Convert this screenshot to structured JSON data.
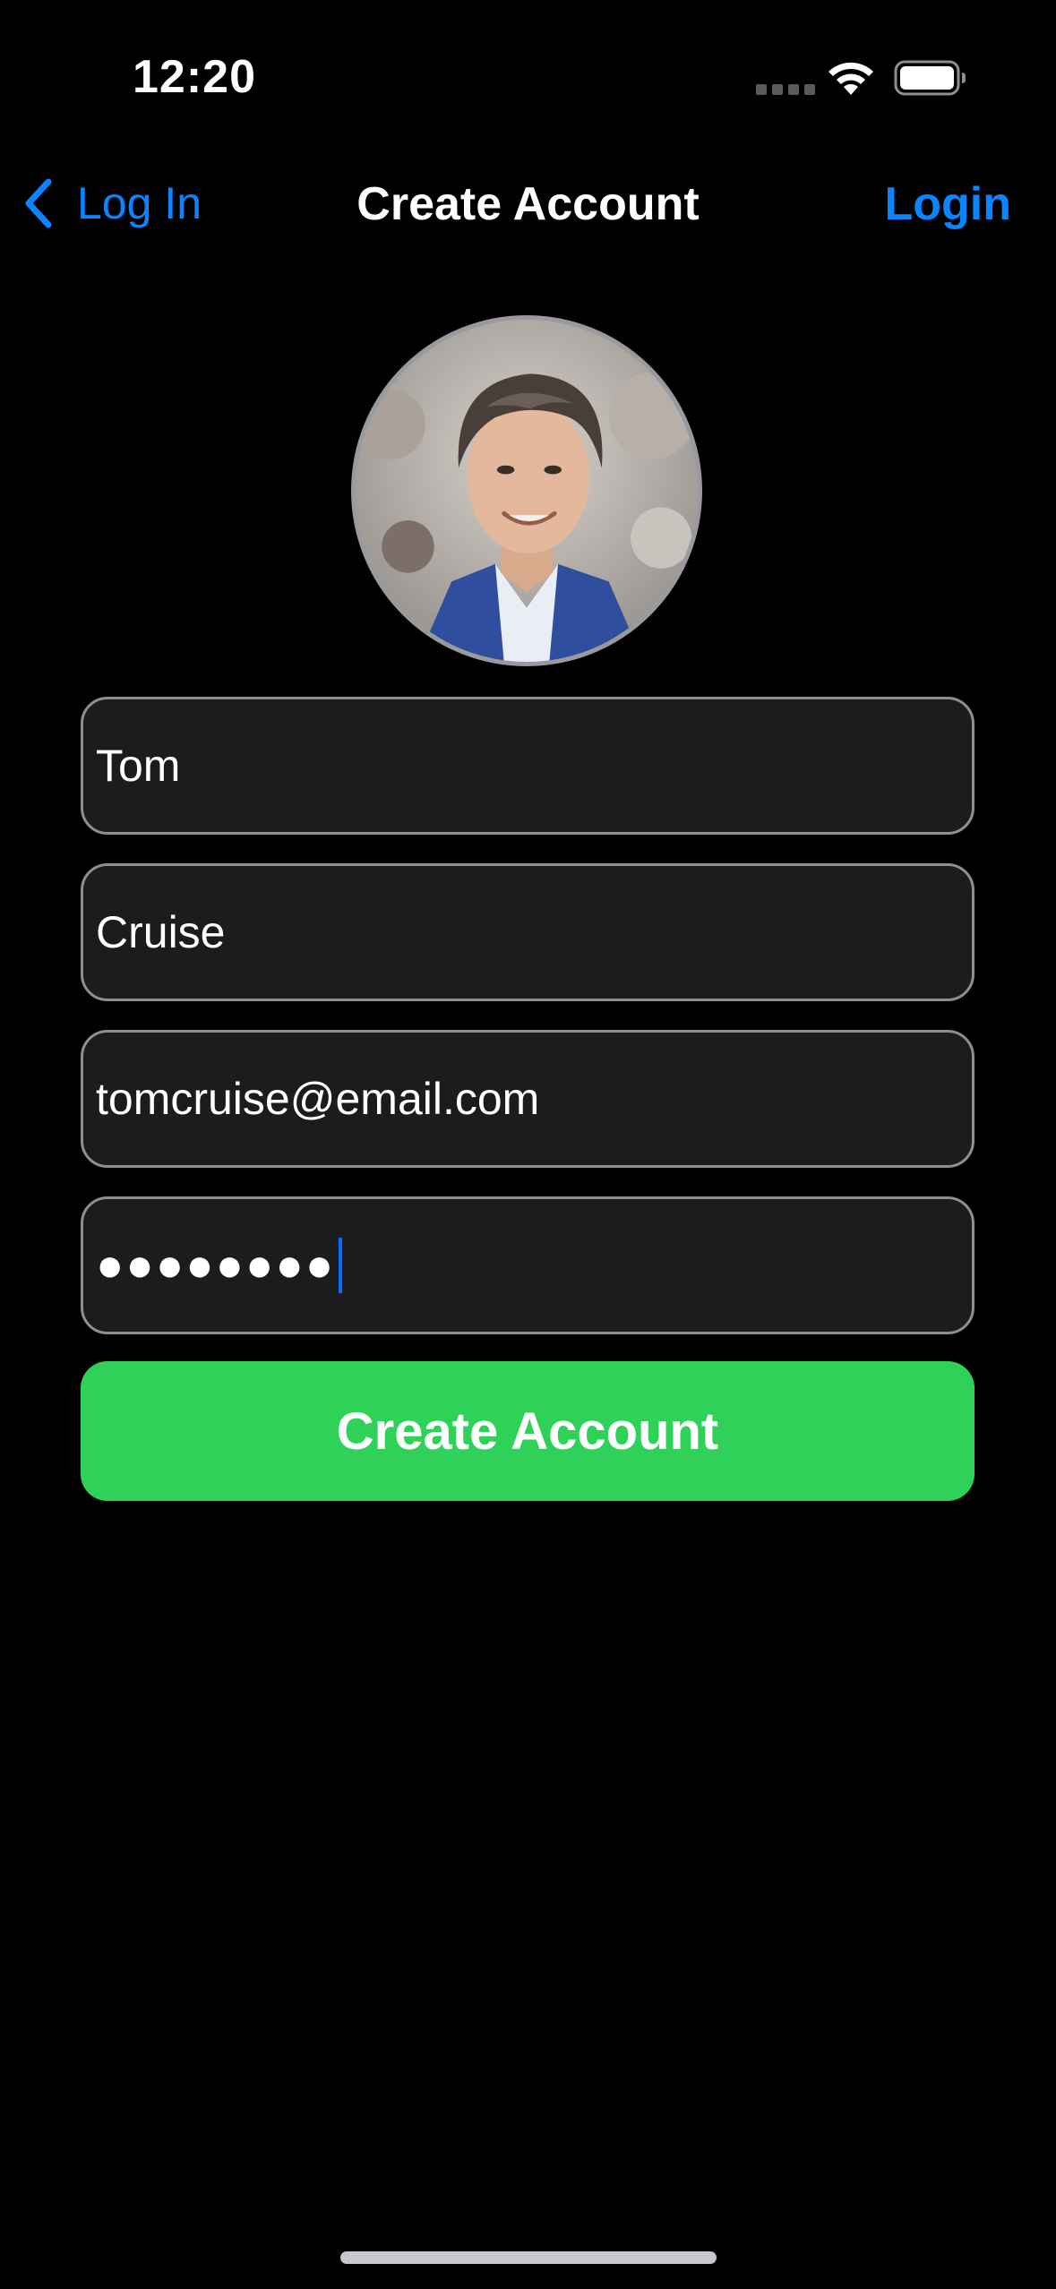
{
  "status_bar": {
    "time": "12:20"
  },
  "nav": {
    "back_label": "Log In",
    "title": "Create Account",
    "right_action": "Login"
  },
  "form": {
    "first_name": "Tom",
    "last_name": "Cruise",
    "email": "tomcruise@email.com",
    "password_masked": "●●●●●●●●"
  },
  "submit": {
    "label": "Create Account"
  },
  "colors": {
    "accent": "#0a84ff",
    "primary_button": "#30d158",
    "field_background": "#1c1c1e",
    "field_border": "#8e8e93",
    "background": "#000000"
  },
  "icons": {
    "back": "chevron-left-icon",
    "wifi": "wifi-icon",
    "battery": "battery-icon",
    "signal": "cellular-signal-icon"
  }
}
